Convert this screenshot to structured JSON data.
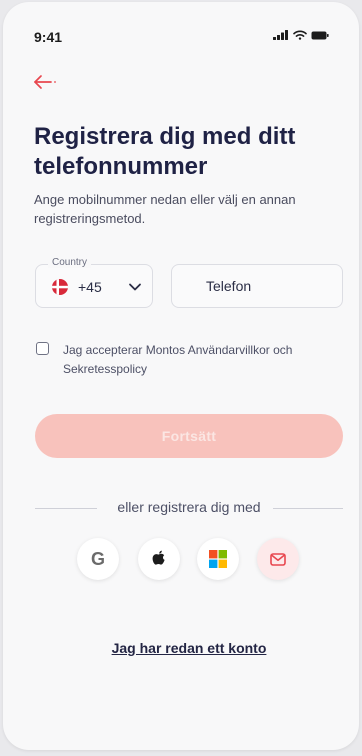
{
  "status_bar": {
    "time": "9:41"
  },
  "header": {
    "title": "Registrera dig med ditt telefonnummer",
    "subtitle": "Ange mobilnummer nedan eller välj en annan registreringsmetod."
  },
  "form": {
    "country_label": "Country",
    "dial_code": "+45",
    "country_flag": "denmark-flag",
    "phone_placeholder": "Telefon",
    "phone_value": "",
    "terms_checked": false,
    "terms_text": "Jag accepterar Montos Användarvillkor och Sekretesspolicy",
    "continue_label": "Fortsätt"
  },
  "social": {
    "divider_text": "eller registrera dig med",
    "providers": [
      {
        "name": "google",
        "glyph": "G",
        "icon": "google-icon"
      },
      {
        "name": "apple",
        "icon": "apple-icon"
      },
      {
        "name": "microsoft",
        "icon": "microsoft-icon"
      },
      {
        "name": "email",
        "icon": "mail-icon"
      }
    ]
  },
  "footer": {
    "login_link": "Jag har redan ett konto"
  },
  "colors": {
    "accent": "#e8474f",
    "button_disabled": "#f8c2bc",
    "title": "#1f2245",
    "danish_red": "#d8293a"
  }
}
